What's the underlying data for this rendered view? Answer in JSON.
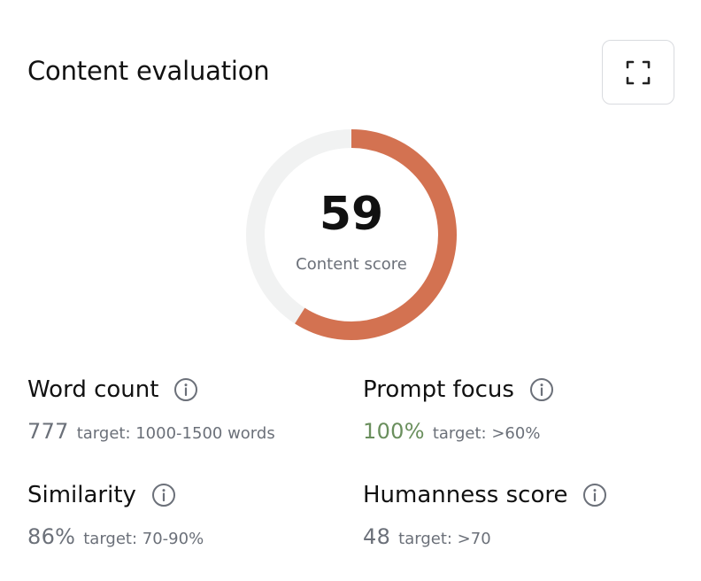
{
  "header": {
    "title": "Content evaluation",
    "expand_icon": "expand-icon"
  },
  "gauge": {
    "value": "59",
    "label": "Content score",
    "percent": 59,
    "fill_color": "#d37251",
    "track_color": "#f1f2f2"
  },
  "metrics": [
    {
      "name": "Word count",
      "value": "777",
      "target": "target: 1000-1500 words",
      "status": "neutral",
      "icon": "info-icon"
    },
    {
      "name": "Prompt focus",
      "value": "100%",
      "target": "target: >60%",
      "status": "good",
      "icon": "info-icon"
    },
    {
      "name": "Similarity",
      "value": "86%",
      "target": "target: 70-90%",
      "status": "neutral",
      "icon": "info-icon"
    },
    {
      "name": "Humanness score",
      "value": "48",
      "target": "target: >70",
      "status": "neutral",
      "icon": "info-icon"
    }
  ],
  "colors": {
    "good": "#6a8f5d",
    "muted": "#6b7079",
    "text": "#111111"
  }
}
